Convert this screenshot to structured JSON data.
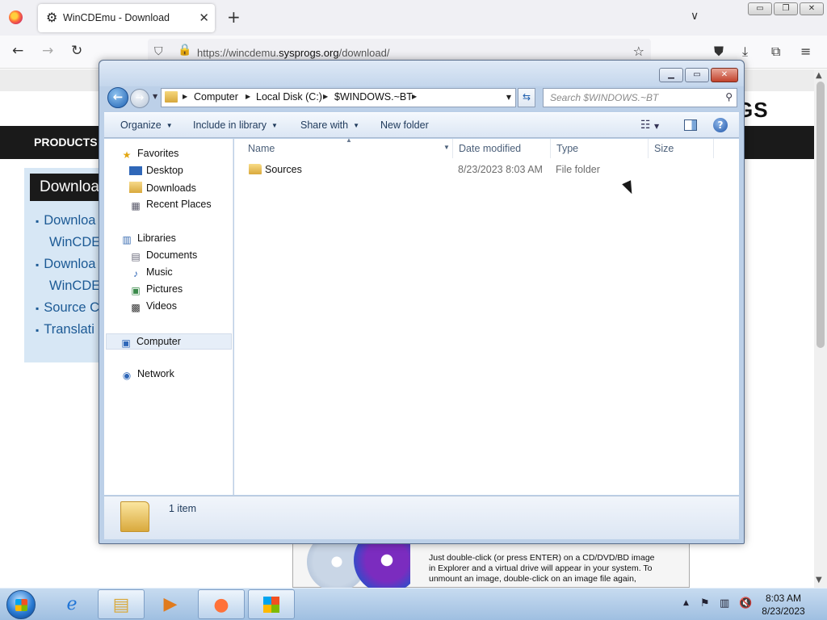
{
  "browser": {
    "tab_title": "WinCDEmu - Download",
    "tab_favicon": "gear-icon",
    "url_prefix": "https://wincdemu.",
    "url_host": "sysprogs.org",
    "url_path": "/download/",
    "new_tab": "+",
    "tab_close": "✕",
    "tab_list": "∨",
    "win_min": "▭",
    "win_max": "❐",
    "win_close": "✕"
  },
  "webpage": {
    "logo": "GS",
    "nav_item": "PRODUCTS",
    "box_title": "Downloa",
    "links": [
      "Downloa",
      "WinCDEr",
      "Downloa",
      "WinCDEr",
      "Source C",
      "Translati"
    ],
    "promo_text": "Just double-click (or press ENTER) on a CD/DVD/BD image in Explorer and a virtual drive will appear in your system. To unmount an image, double-click on an image file again,"
  },
  "explorer": {
    "breadcrumb": [
      "Computer",
      "Local Disk (C:)",
      "$WINDOWS.~BT"
    ],
    "search_placeholder": "Search $WINDOWS.~BT",
    "toolbar": {
      "organize": "Organize",
      "include_in_library": "Include in library",
      "share_with": "Share with",
      "new_folder": "New folder"
    },
    "nav": {
      "favorites": "Favorites",
      "desktop": "Desktop",
      "downloads": "Downloads",
      "recent_places": "Recent Places",
      "libraries": "Libraries",
      "documents": "Documents",
      "music": "Music",
      "pictures": "Pictures",
      "videos": "Videos",
      "computer": "Computer",
      "network": "Network"
    },
    "columns": [
      "Name",
      "Date modified",
      "Type",
      "Size"
    ],
    "files": [
      {
        "name": "Sources",
        "date_modified": "8/23/2023 8:03 AM",
        "type": "File folder",
        "size": ""
      }
    ],
    "status": "1 item"
  },
  "taskbar": {
    "time": "8:03 AM",
    "date": "8/23/2023"
  }
}
